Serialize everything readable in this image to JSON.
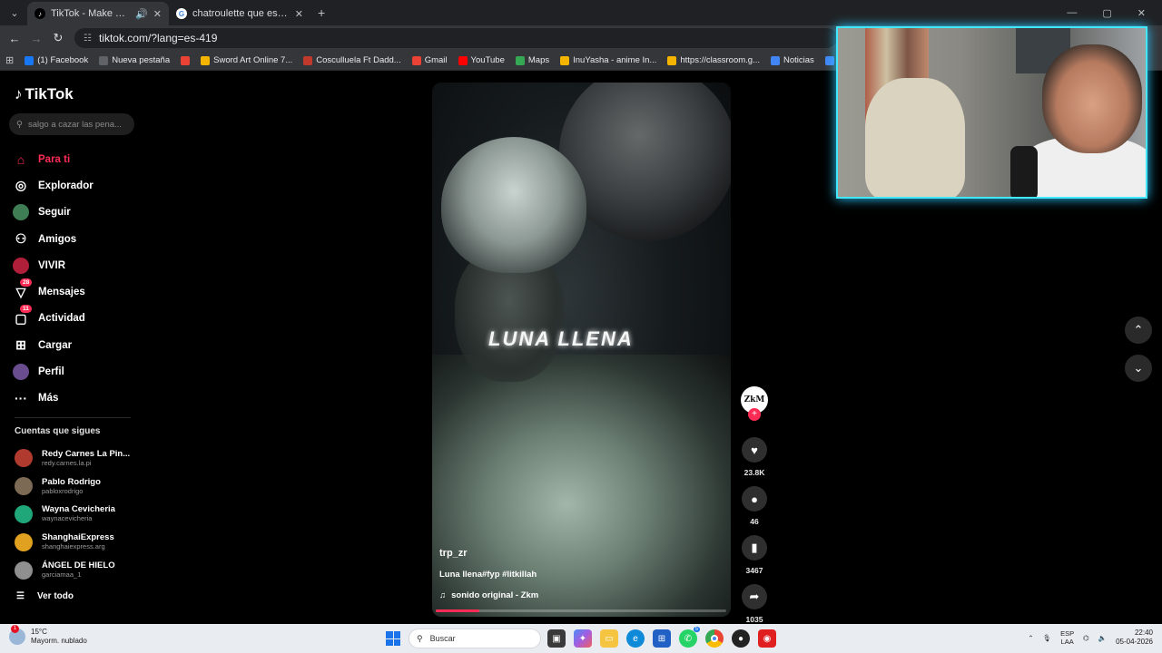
{
  "browser": {
    "tabs": [
      {
        "title": "TikTok - Make Your Day",
        "active": true
      },
      {
        "title": "chatroulette que es - Buscar con",
        "active": false
      }
    ],
    "url": "tiktok.com/?lang=es-419",
    "bookmarks": [
      {
        "label": "(1) Facebook",
        "color": "#1877f2"
      },
      {
        "label": "Nueva pestaña",
        "color": "#5f6368"
      },
      {
        "label": "",
        "color": "#ea4335"
      },
      {
        "label": "Sword Art Online 7...",
        "color": "#f4b400"
      },
      {
        "label": "Cosculluela Ft Dadd...",
        "color": "#c0392b"
      },
      {
        "label": "Gmail",
        "color": "#ea4335"
      },
      {
        "label": "YouTube",
        "color": "#ff0000"
      },
      {
        "label": "Maps",
        "color": "#34a853"
      },
      {
        "label": "InuYasha - anime In...",
        "color": "#f4b400"
      },
      {
        "label": "https://classroom.g...",
        "color": "#f4b400"
      },
      {
        "label": "Noticias",
        "color": "#4285f4"
      },
      {
        "label": "Traducir",
        "color": "#4285f4"
      },
      {
        "label": "Ver Anim",
        "color": "#f4b400"
      }
    ]
  },
  "tiktok": {
    "logo": "TikTok",
    "search_placeholder": "salgo a cazar las pena...",
    "nav": [
      {
        "label": "Para ti",
        "icon": "home-icon",
        "glyph": "⌂",
        "active": true
      },
      {
        "label": "Explorador",
        "icon": "compass-icon",
        "glyph": "◎"
      },
      {
        "label": "Seguir",
        "icon": "following-avatar-icon",
        "glyph": ""
      },
      {
        "label": "Amigos",
        "icon": "friends-icon",
        "glyph": "⚇"
      },
      {
        "label": "VIVIR",
        "icon": "live-icon",
        "glyph": ""
      },
      {
        "label": "Mensajes",
        "icon": "messages-icon",
        "glyph": "▽",
        "badge": "28"
      },
      {
        "label": "Actividad",
        "icon": "activity-icon",
        "glyph": "▢",
        "badge": "11"
      },
      {
        "label": "Cargar",
        "icon": "upload-icon",
        "glyph": "⊞"
      },
      {
        "label": "Perfil",
        "icon": "profile-avatar-icon",
        "glyph": ""
      },
      {
        "label": "Más",
        "icon": "more-icon",
        "glyph": "···"
      }
    ],
    "following_title": "Cuentas que sigues",
    "following": [
      {
        "name": "Redy Carnes La Pin...",
        "handle": "redy.carnes.la.pi",
        "color": "#b13a2f"
      },
      {
        "name": "Pablo Rodrigo",
        "handle": "pabloxrodrigo",
        "color": "#7d6a55"
      },
      {
        "name": "Wayna Cevicheria",
        "handle": "waynacevicheria",
        "color": "#1fa77a"
      },
      {
        "name": "ShanghaiExpress",
        "handle": "shanghaiexpress.arg",
        "color": "#e0a020"
      },
      {
        "name": "ÁNGEL DE HIELO",
        "handle": "garciamaa_1",
        "color": "#8f8f8f"
      }
    ],
    "see_all": "Ver todo"
  },
  "video": {
    "overlay_text": "LUNA  LLENA",
    "username": "trp_zr",
    "caption": "Luna llena#fyp #litkillah",
    "sound": "sonido original - Zkm",
    "progress": 0.15
  },
  "actions": {
    "creator_avatar": "ZkM",
    "likes": "23.8K",
    "comments": "46",
    "saves": "3467",
    "shares": "1035"
  },
  "taskbar": {
    "temp": "15°C",
    "weather": "Mayorm. nublado",
    "weather_badge": "1",
    "search_placeholder": "Buscar",
    "lang_top": "ESP",
    "lang_bottom": "LAA",
    "time": "22:40",
    "date": "05-04-2026",
    "whatsapp_count": "5"
  }
}
